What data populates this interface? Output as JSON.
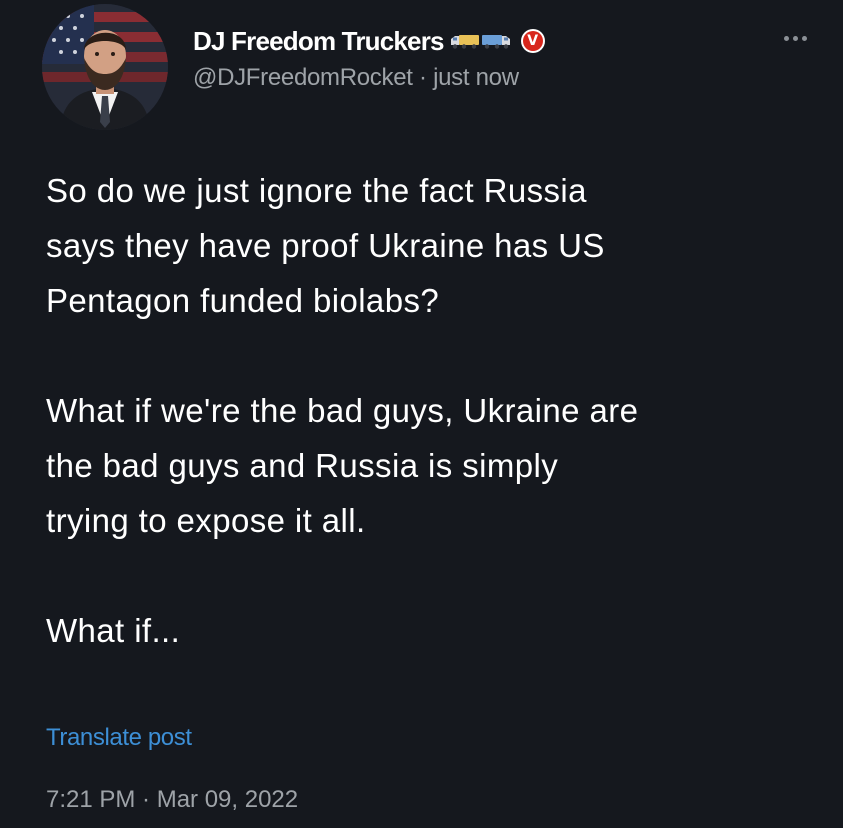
{
  "author": {
    "display_name": "DJ Freedom Truckers",
    "name_emoji_icons": [
      "truck-icon",
      "truck-icon"
    ],
    "verified_badge_letter": "V",
    "handle": "@DJFreedomRocket",
    "separator": " · ",
    "relative_time": "just now"
  },
  "post": {
    "paragraphs": [
      "So do we just ignore the fact Russia\nsays they have proof Ukraine has US\nPentagon funded biolabs?",
      "What if we're the bad guys, Ukraine are\nthe bad guys and Russia is simply\ntrying to expose it all.",
      "What if..."
    ],
    "translate_label": "Translate post",
    "timestamp": "7:21 PM · Mar 09, 2022"
  },
  "colors": {
    "background": "#15181e",
    "text": "#ffffff",
    "secondary_text": "#9ea3a8",
    "link": "#3d8fd6",
    "badge": "#d8261c"
  }
}
